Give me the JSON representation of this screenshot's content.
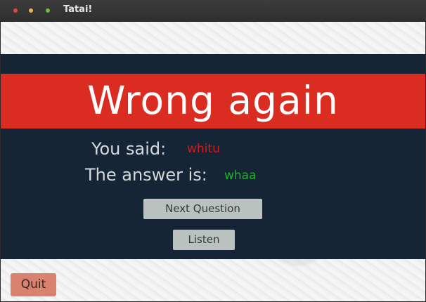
{
  "window": {
    "title": "Tatai!",
    "controls": [
      "close-icon",
      "minimize-icon",
      "maximize-icon"
    ]
  },
  "result": {
    "heading": "Wrong again",
    "you_said_label": "You said:",
    "you_said_value": "whitu",
    "answer_label": "The answer is:",
    "answer_value": "whaa"
  },
  "buttons": {
    "next_question": "Next Question",
    "listen": "Listen",
    "quit": "Quit"
  },
  "colors": {
    "banner": "#db2c22",
    "panel": "#162536",
    "wrong_answer": "#d01c1c",
    "correct_answer": "#22b22a",
    "quit_button": "#d8826f",
    "action_button": "#b9c2bf"
  }
}
